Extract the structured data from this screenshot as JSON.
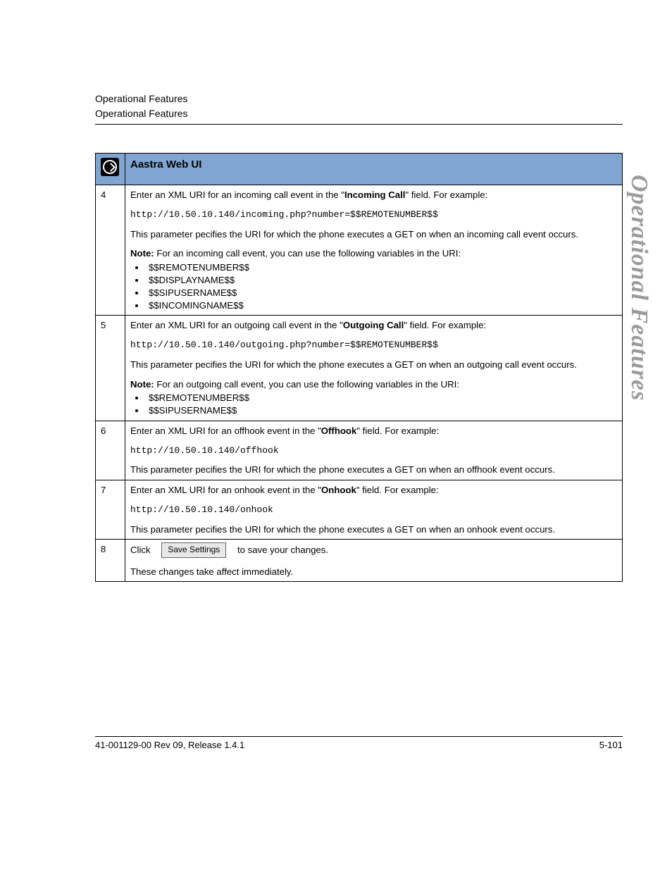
{
  "header": {
    "line1": "Operational Features",
    "line2": "Operational Features"
  },
  "side_label": "Operational Features",
  "table": {
    "title": "Aastra Web UI",
    "rows": [
      {
        "num": "4",
        "intro_pre": "Enter an XML URI for an incoming call event in the \"",
        "intro_bold": "Incoming Call",
        "intro_post": "\" field. For example:",
        "code": "http://10.50.10.140/incoming.php?number=$$REMOTENUMBER$$",
        "desc": "This parameter pecifies the URI for which the phone executes a GET on when an incoming call event occurs.",
        "note_label": "Note:",
        "note_text": " For an incoming call event, you can use the following variables in the URI:",
        "vars": [
          "$$REMOTENUMBER$$",
          "$$DISPLAYNAME$$",
          "$$SIPUSERNAME$$",
          "$$INCOMINGNAME$$"
        ]
      },
      {
        "num": "5",
        "intro_pre": "Enter an XML URI for an outgoing call event in the \"",
        "intro_bold": "Outgoing Call",
        "intro_post": "\" field. For example:",
        "code": "http://10.50.10.140/outgoing.php?number=$$REMOTENUMBER$$",
        "desc": "This parameter pecifies the URI for which the phone executes a GET on when an outgoing call event occurs.",
        "note_label": "Note:",
        "note_text": " For an outgoing call event, you can use the following variables in the URI:",
        "vars": [
          "$$REMOTENUMBER$$",
          "$$SIPUSERNAME$$"
        ]
      },
      {
        "num": "6",
        "intro_pre": "Enter an XML URI for an offhook event in the \"",
        "intro_bold": "Offhook",
        "intro_post": "\" field. For example:",
        "code": "http://10.50.10.140/offhook",
        "desc": "This parameter pecifies the URI for which the phone executes a GET on when an offhook event occurs."
      },
      {
        "num": "7",
        "intro_pre": "Enter an XML URI for an onhook event in the \"",
        "intro_bold": "Onhook",
        "intro_post": "\" field. For example:",
        "code": "http://10.50.10.140/onhook",
        "desc": "This parameter pecifies the URI for which the phone executes a GET on when an onhook event occurs."
      },
      {
        "num": "8",
        "click_word": "Click",
        "button_label": "Save Settings",
        "click_post": "to save your changes.",
        "desc2": "These changes take affect immediately."
      }
    ]
  },
  "footer": {
    "left": "41-001129-00 Rev 09, Release 1.4.1",
    "right": "5-101"
  }
}
